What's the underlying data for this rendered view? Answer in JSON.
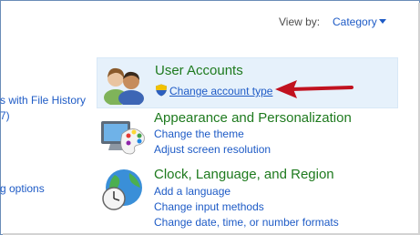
{
  "header": {
    "view_by_label": "View by:",
    "view_by_value": "Category"
  },
  "left_links": [
    "s with File History",
    "7)",
    "g options"
  ],
  "categories": [
    {
      "title": "User Accounts",
      "links": [
        "Change account type"
      ],
      "icon": "users-icon",
      "highlighted": true
    },
    {
      "title": "Appearance and Personalization",
      "links": [
        "Change the theme",
        "Adjust screen resolution"
      ],
      "icon": "monitor-palette-icon"
    },
    {
      "title": "Clock, Language, and Region",
      "links": [
        "Add a language",
        "Change input methods",
        "Change date, time, or number formats"
      ],
      "icon": "globe-clock-icon"
    }
  ],
  "colors": {
    "link_blue": "#1e5bc6",
    "category_green": "#1e7a1e",
    "highlight_bg": "#e6f1fb",
    "annotation_arrow": "#c1121f"
  }
}
